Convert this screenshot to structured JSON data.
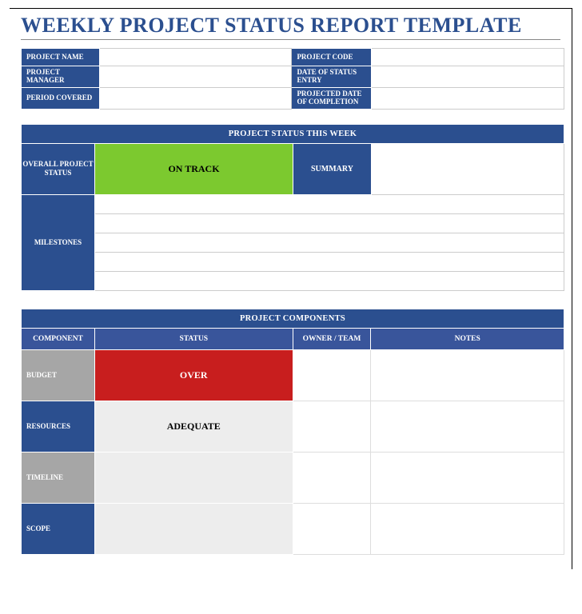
{
  "title": "WEEKLY PROJECT STATUS REPORT TEMPLATE",
  "info": {
    "project_name_label": "PROJECT NAME",
    "project_name": "",
    "project_code_label": "PROJECT CODE",
    "project_code": "",
    "project_manager_label": "PROJECT MANAGER",
    "project_manager": "",
    "date_of_status_entry_label": "DATE OF STATUS ENTRY",
    "date_of_status_entry": "",
    "period_covered_label": "PERIOD COVERED",
    "period_covered": "",
    "projected_completion_label": "PROJECTED DATE OF COMPLETION",
    "projected_completion": ""
  },
  "status_week": {
    "header": "PROJECT STATUS THIS WEEK",
    "overall_label": "OVERALL PROJECT STATUS",
    "overall_value": "ON TRACK",
    "summary_label": "SUMMARY",
    "summary_value": "",
    "milestones_label": "MILESTONES",
    "milestones": [
      "",
      "",
      "",
      "",
      ""
    ]
  },
  "components": {
    "header": "PROJECT COMPONENTS",
    "columns": {
      "component": "COMPONENT",
      "status": "STATUS",
      "owner": "OWNER / TEAM",
      "notes": "NOTES"
    },
    "rows": [
      {
        "label": "BUDGET",
        "label_style": "gray",
        "status": "OVER",
        "status_style": "red",
        "owner": "",
        "notes": ""
      },
      {
        "label": "RESOURCES",
        "label_style": "blue",
        "status": "ADEQUATE",
        "status_style": "lgray",
        "owner": "",
        "notes": ""
      },
      {
        "label": "TIMELINE",
        "label_style": "gray",
        "status": "",
        "status_style": "lgray",
        "owner": "",
        "notes": ""
      },
      {
        "label": "SCOPE",
        "label_style": "blue",
        "status": "",
        "status_style": "lgray",
        "owner": "",
        "notes": ""
      }
    ]
  },
  "colors": {
    "primary": "#2b4f8f",
    "green": "#7cc92f",
    "red": "#c81e1e",
    "gray": "#a6a6a6",
    "lightgray": "#ededed"
  }
}
